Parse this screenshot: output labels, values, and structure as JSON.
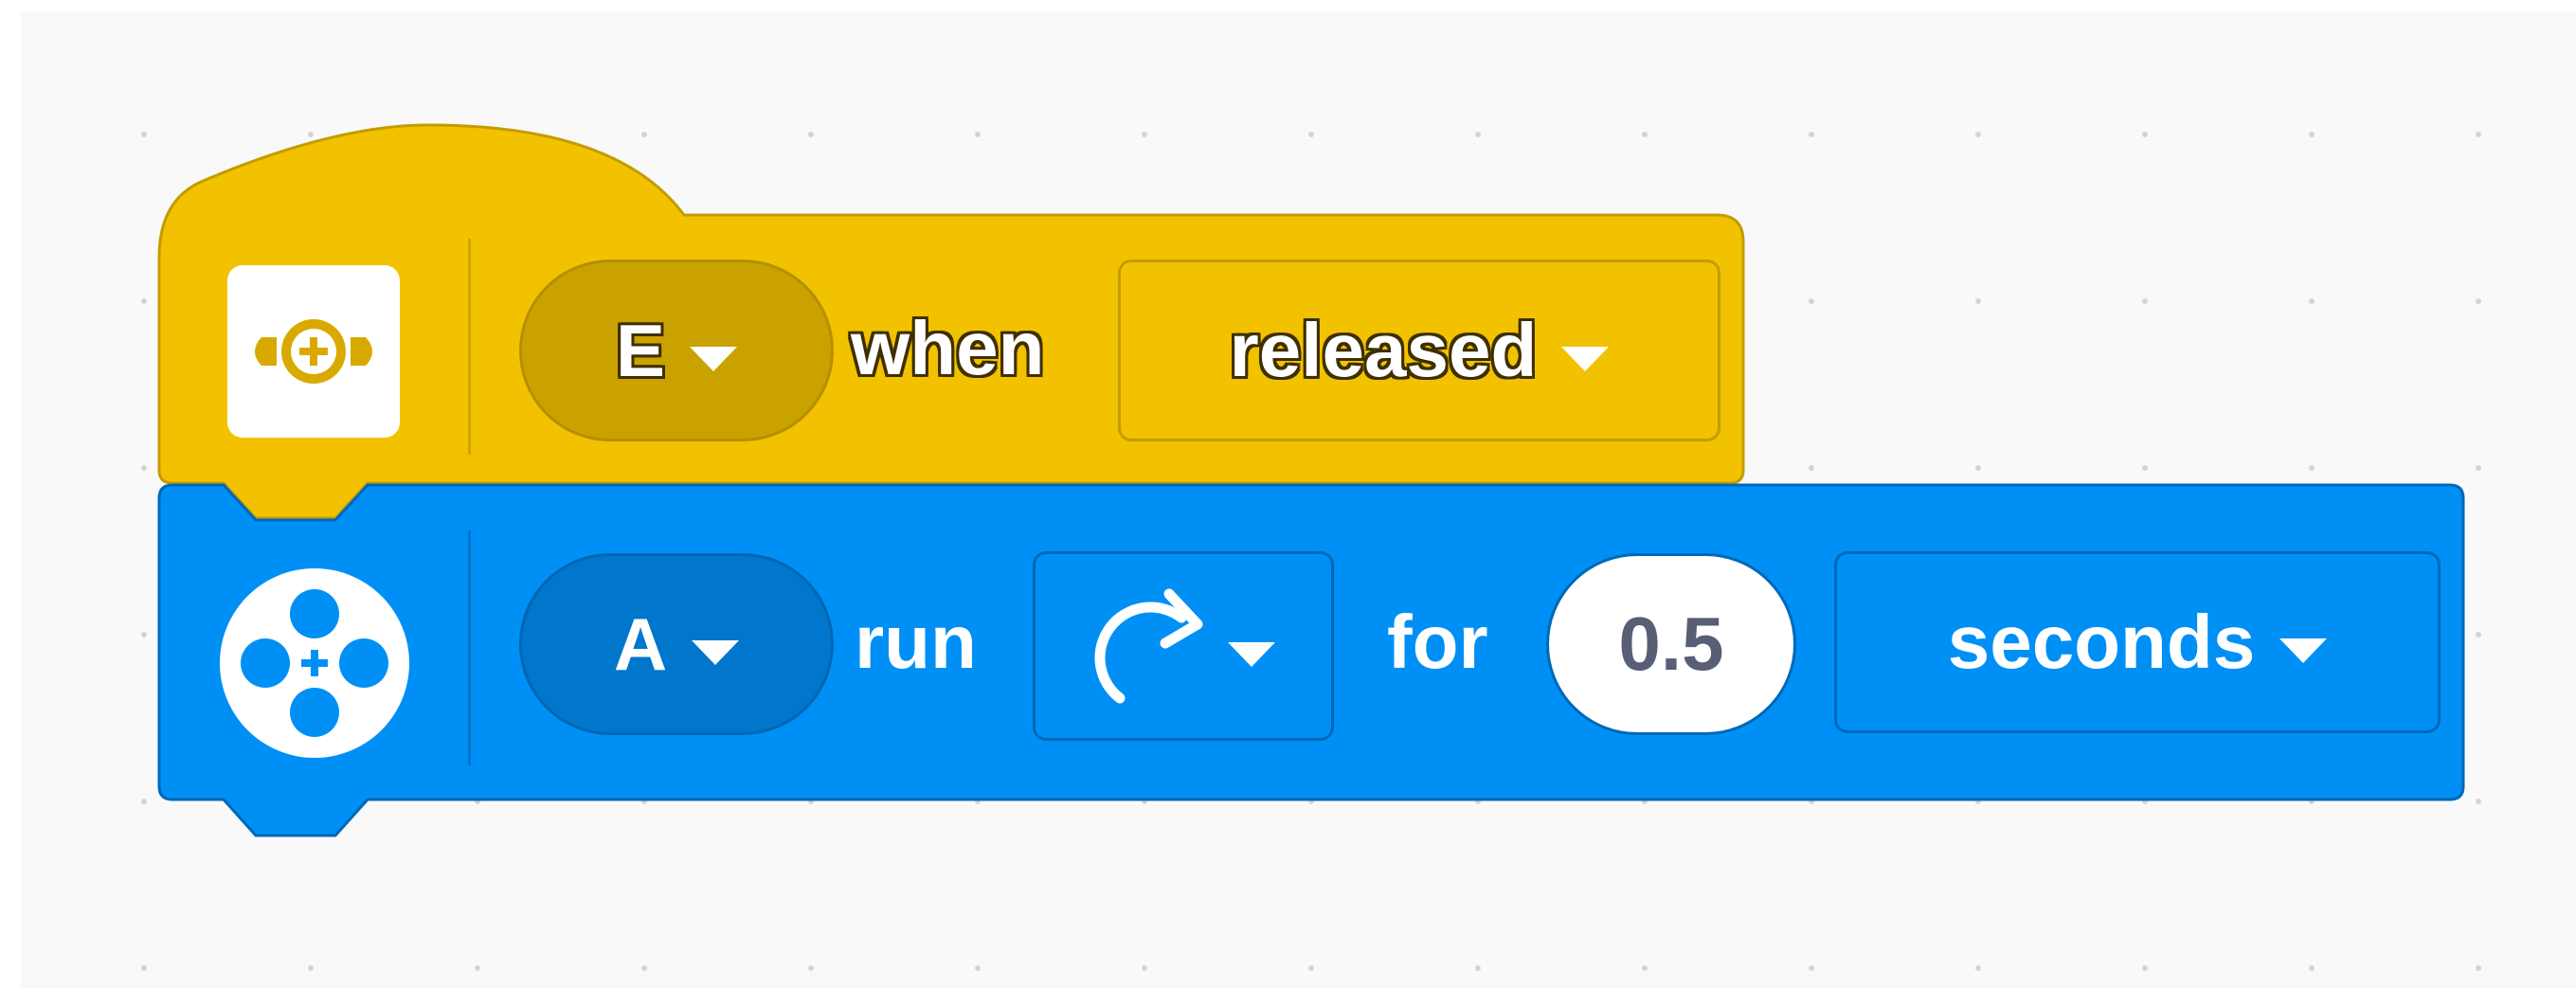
{
  "colors": {
    "event_yellow": "#f2c200",
    "event_dark": "#c9a200",
    "event_border": "#c49c00",
    "motor_blue": "#0090f5",
    "motor_dark": "#0076cc",
    "motor_border": "#0068b8",
    "canvas_bg": "#f9f9f9"
  },
  "event_block": {
    "icon": "force-sensor-icon",
    "port": "E",
    "text_when": "when",
    "state": "released"
  },
  "motor_block": {
    "icon": "motor-icon",
    "port": "A",
    "text_run": "run",
    "direction_icon": "clockwise-arrow-icon",
    "text_for": "for",
    "amount": "0.5",
    "unit": "seconds"
  }
}
